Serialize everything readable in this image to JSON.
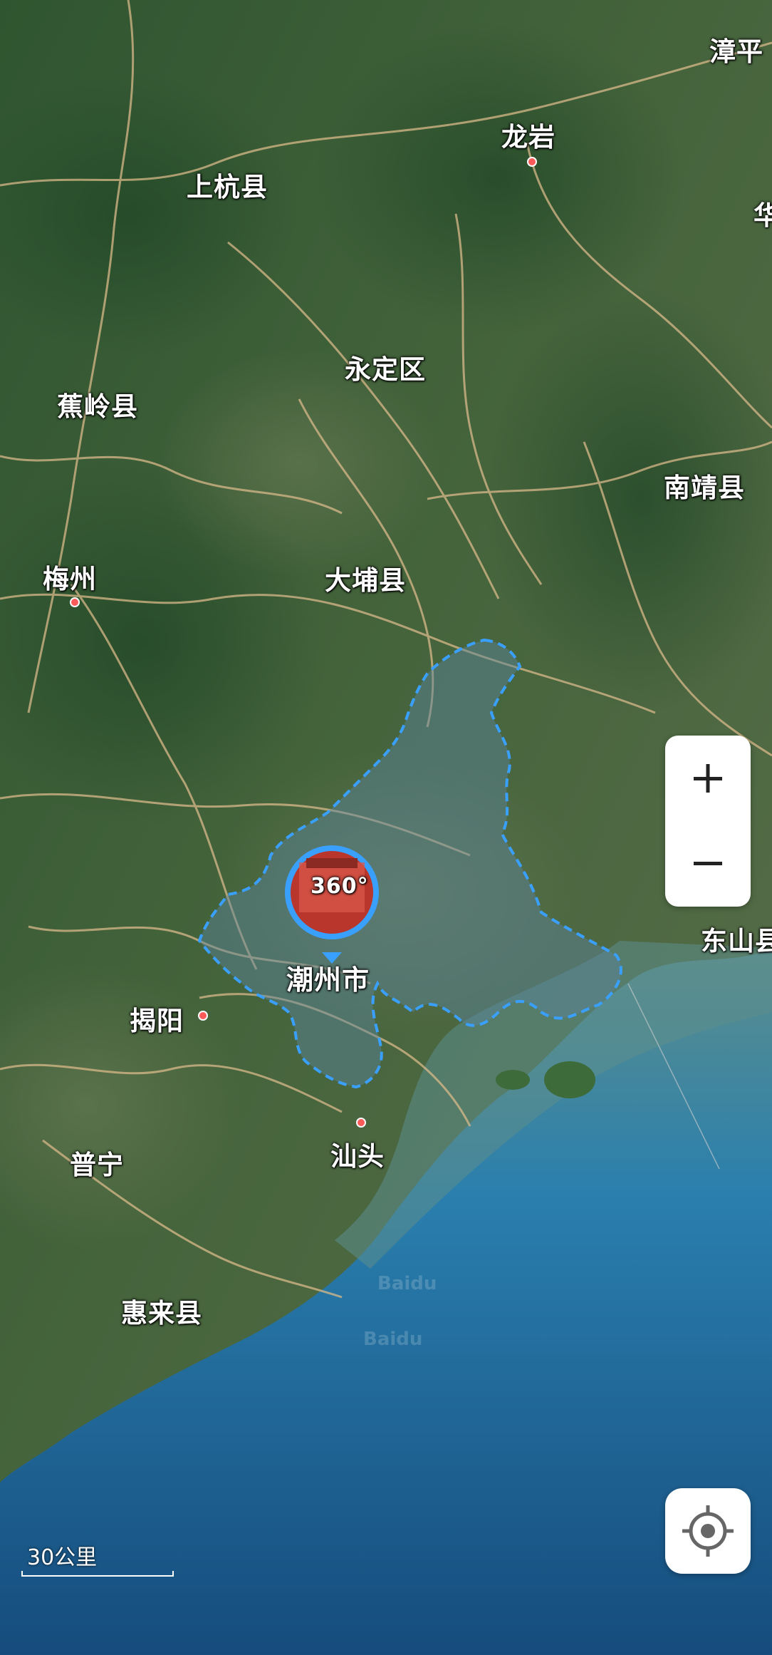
{
  "map": {
    "places": [
      {
        "key": "zhangping",
        "label": "漳平",
        "dot": false
      },
      {
        "key": "longyan",
        "label": "龙岩",
        "dot": true
      },
      {
        "key": "hua",
        "label": "华",
        "dot": false
      },
      {
        "key": "shanghang",
        "label": "上杭县",
        "dot": false
      },
      {
        "key": "yongding",
        "label": "永定区",
        "dot": false
      },
      {
        "key": "jiaoling",
        "label": "蕉岭县",
        "dot": false
      },
      {
        "key": "nanjing",
        "label": "南靖县",
        "dot": false
      },
      {
        "key": "meizhou",
        "label": "梅州",
        "dot": true
      },
      {
        "key": "dabu",
        "label": "大埔县",
        "dot": false
      },
      {
        "key": "dongshan",
        "label": "东山县",
        "dot": false
      },
      {
        "key": "jieyang",
        "label": "揭阳",
        "dot": true
      },
      {
        "key": "shantou",
        "label": "汕头",
        "dot": true
      },
      {
        "key": "puning",
        "label": "普宁",
        "dot": false
      },
      {
        "key": "huilai",
        "label": "惠来县",
        "dot": false
      }
    ],
    "highlighted_region": {
      "label": "潮州市",
      "badge_text": "360°",
      "outline_color": "#3aa0ff"
    },
    "watermark": "Baidu",
    "scale_label": "30公里"
  },
  "controls": {
    "zoom_in_icon": "plus-icon",
    "zoom_out_icon": "minus-icon",
    "locate_icon": "locate-crosshair-icon"
  },
  "colors": {
    "land": "#3f5e35",
    "sea_shallow": "#4a7d88",
    "sea_deep": "#1f5f8f",
    "road": "#d9b98a",
    "marker_dot": "#ff5a5a"
  }
}
